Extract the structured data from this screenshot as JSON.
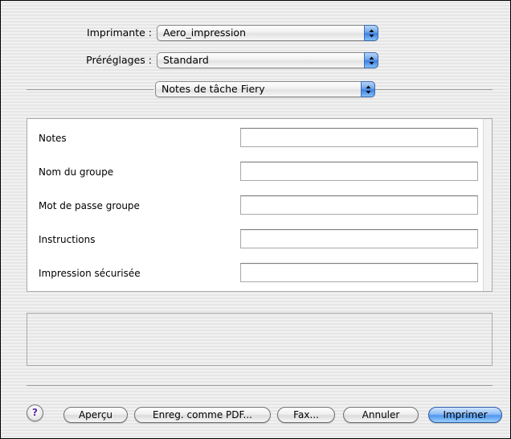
{
  "printer": {
    "label": "Imprimante :",
    "value": "Aero_impression"
  },
  "presets": {
    "label": "Préréglages :",
    "value": "Standard"
  },
  "panel_selector": {
    "value": "Notes de tâche Fiery"
  },
  "fields": [
    {
      "label": "Notes",
      "value": ""
    },
    {
      "label": "Nom du groupe",
      "value": ""
    },
    {
      "label": "Mot de passe groupe",
      "value": ""
    },
    {
      "label": "Instructions",
      "value": ""
    },
    {
      "label": "Impression sécurisée",
      "value": ""
    }
  ],
  "buttons": {
    "help": "?",
    "preview": "Aperçu",
    "save_pdf": "Enreg. comme PDF...",
    "fax": "Fax...",
    "cancel": "Annuler",
    "print": "Imprimer"
  },
  "colors": {
    "default_button": "#4f96ee",
    "help_glyph": "#5a2aa0"
  }
}
